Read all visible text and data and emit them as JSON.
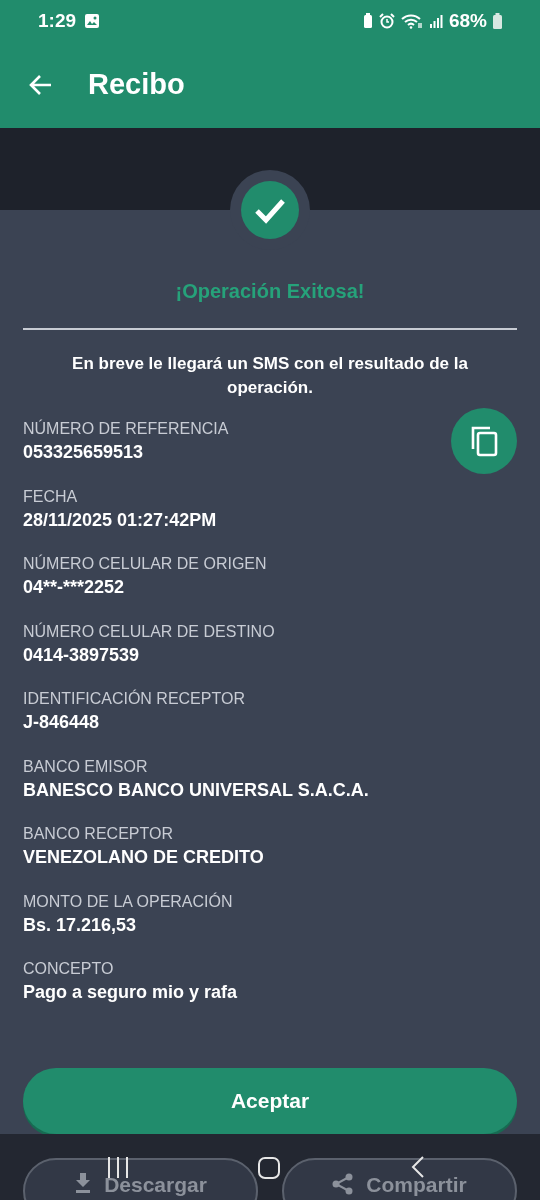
{
  "status_bar": {
    "time": "1:29",
    "battery": "68%"
  },
  "app_bar": {
    "title": "Recibo"
  },
  "result": {
    "title": "¡Operación Exitosa!",
    "message": "En breve le llegará un SMS con el resultado de la operación."
  },
  "fields": [
    {
      "label": "NÚMERO DE REFERENCIA",
      "value": "053325659513",
      "copyable": true
    },
    {
      "label": "FECHA",
      "value": "28/11/2025 01:27:42PM",
      "copyable": false
    },
    {
      "label": "NÚMERO CELULAR DE ORIGEN",
      "value": "04**-***2252",
      "copyable": false
    },
    {
      "label": "NÚMERO CELULAR DE DESTINO",
      "value": "0414-3897539",
      "copyable": false
    },
    {
      "label": "IDENTIFICACIÓN RECEPTOR",
      "value": "J-846448",
      "copyable": false
    },
    {
      "label": "BANCO EMISOR",
      "value": "BANESCO BANCO UNIVERSAL S.A.C.A.",
      "copyable": false
    },
    {
      "label": "BANCO RECEPTOR",
      "value": "VENEZOLANO DE CREDITO",
      "copyable": false
    },
    {
      "label": "MONTO DE LA OPERACIÓN",
      "value": "Bs. 17.216,53",
      "copyable": false
    },
    {
      "label": "CONCEPTO",
      "value": "Pago a seguro mio y rafa",
      "copyable": false
    }
  ],
  "primary_button": "Aceptar",
  "secondary_buttons": [
    {
      "kind": "download",
      "label": "Descargar"
    },
    {
      "kind": "share",
      "label": "Compartir"
    }
  ]
}
